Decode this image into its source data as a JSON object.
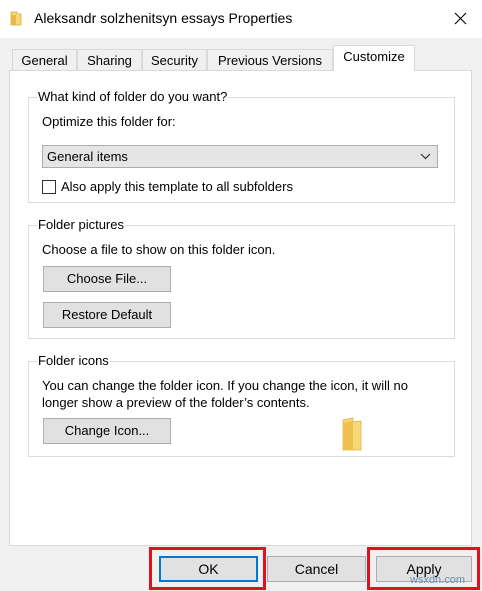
{
  "window": {
    "title": "Aleksandr solzhenitsyn essays Properties",
    "icon": "folder-icon",
    "close_icon": "close-icon"
  },
  "tabs": [
    {
      "label": "General",
      "active": false
    },
    {
      "label": "Sharing",
      "active": false
    },
    {
      "label": "Security",
      "active": false
    },
    {
      "label": "Previous Versions",
      "active": false
    },
    {
      "label": "Customize",
      "active": true
    }
  ],
  "folder_type": {
    "group_title": "What kind of folder do you want?",
    "optimize_label": "Optimize this folder for:",
    "selected": "General items",
    "apply_subfolders_label": "Also apply this template to all subfolders",
    "apply_subfolders_checked": false
  },
  "folder_pictures": {
    "group_title": "Folder pictures",
    "description": "Choose a file to show on this folder icon.",
    "choose_file_label": "Choose File...",
    "restore_default_label": "Restore Default"
  },
  "folder_icons": {
    "group_title": "Folder icons",
    "description_line1": "You can change the folder icon. If you change the icon, it will no",
    "description_line2": "longer show a preview of the folder’s contents.",
    "change_icon_label": "Change Icon..."
  },
  "footer": {
    "ok_label": "OK",
    "cancel_label": "Cancel",
    "apply_label": "Apply"
  },
  "watermark": "wsxdn.com",
  "colors": {
    "highlight": "#e0111f",
    "focus": "#0078d7",
    "folder": "#f8d775"
  }
}
